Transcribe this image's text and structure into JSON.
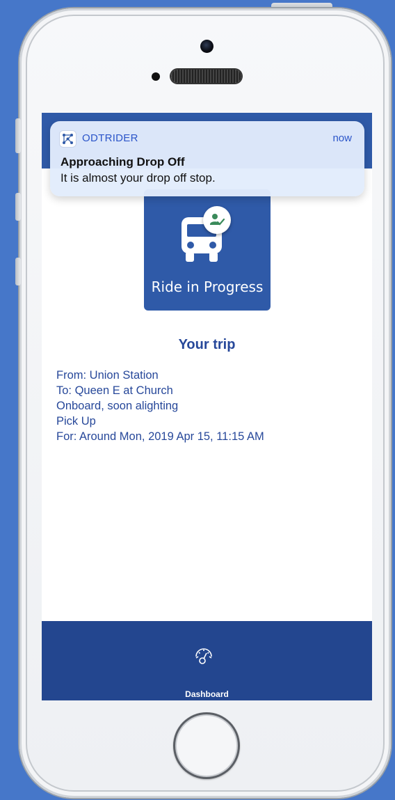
{
  "notification": {
    "app_name": "ODTRIDER",
    "time": "now",
    "title": "Approaching Drop Off",
    "body": "It is almost your drop off stop."
  },
  "status_card": {
    "label": "Ride in Progress",
    "icon": "bus-icon",
    "badge_icon": "person-check-icon"
  },
  "trip": {
    "heading": "Your trip",
    "lines": [
      "From: Union Station",
      "To: Queen E at Church",
      "Onboard, soon alighting",
      "Pick Up",
      "For: Around Mon, 2019 Apr 15, 11:15 AM"
    ]
  },
  "bottom_nav": {
    "item_label": "Dashboard",
    "item_icon": "speedometer-icon"
  },
  "colors": {
    "brand_blue": "#2f5aa8",
    "nav_blue": "#23468f",
    "text_blue": "#27489a",
    "badge_green": "#3a8a5a",
    "background": "#4677c9"
  }
}
